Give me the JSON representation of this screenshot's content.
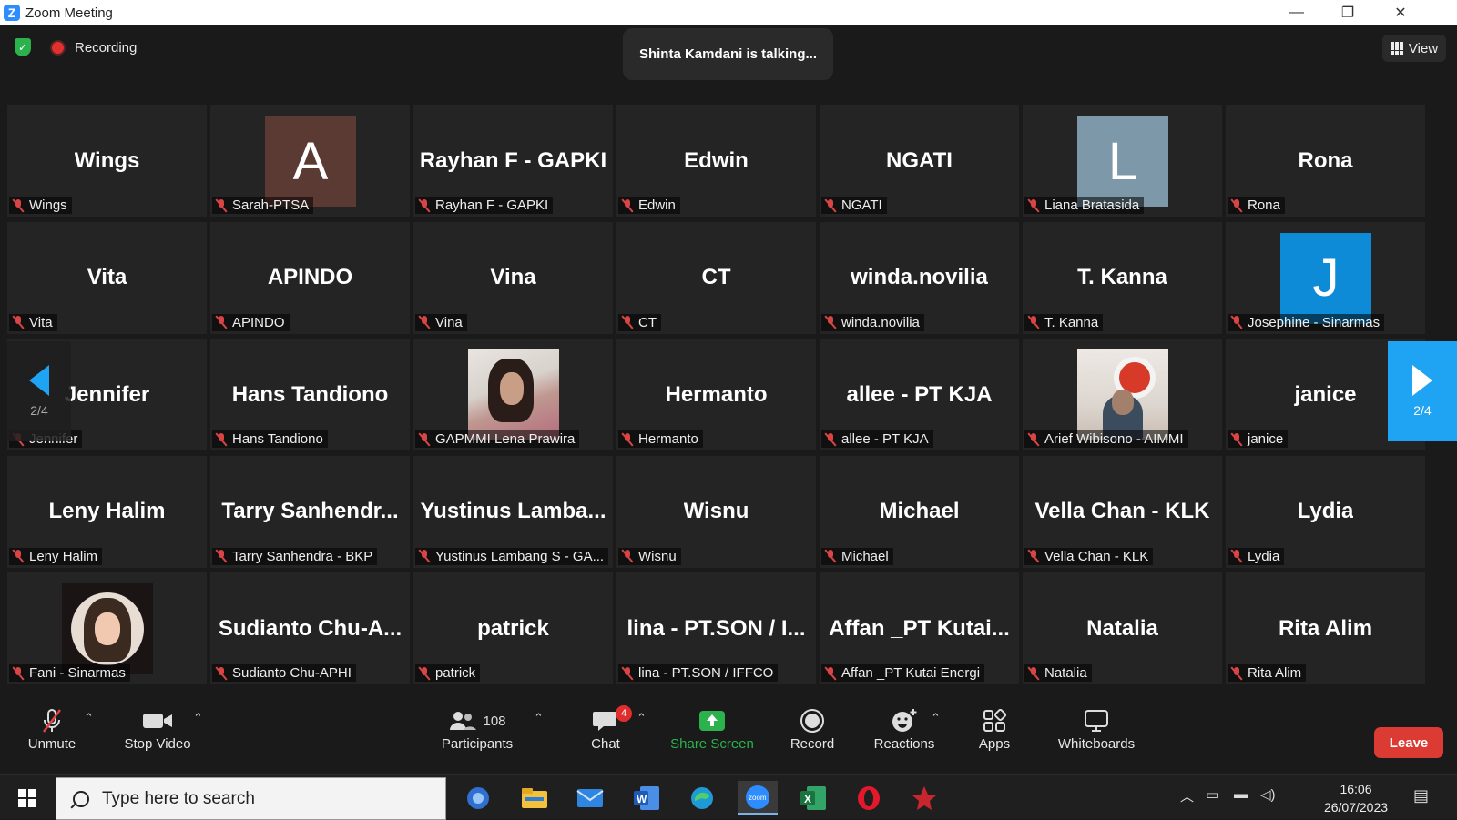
{
  "window": {
    "title": "Zoom Meeting",
    "minimize": "—",
    "restore": "❐",
    "close": "✕"
  },
  "topbar": {
    "recording_label": "Recording",
    "talking_banner": "Shinta Kamdani is talking...",
    "view_label": "View"
  },
  "tiles": [
    {
      "display": "Wings",
      "name": "Wings"
    },
    {
      "display": "A",
      "name": "Sarah-PTSA",
      "avatar_color": "#5b3a33"
    },
    {
      "display": "Rayhan F - GAPKI",
      "name": "Rayhan F - GAPKI"
    },
    {
      "display": "Edwin",
      "name": "Edwin"
    },
    {
      "display": "NGATI",
      "name": "NGATI"
    },
    {
      "display": "L",
      "name": "Liana Bratasida",
      "avatar_color": "#7d98a9"
    },
    {
      "display": "Rona",
      "name": "Rona"
    },
    {
      "display": "Vita",
      "name": "Vita"
    },
    {
      "display": "APINDO",
      "name": "APINDO"
    },
    {
      "display": "Vina",
      "name": "Vina"
    },
    {
      "display": "CT",
      "name": "CT"
    },
    {
      "display": "winda.novilia",
      "name": "winda.novilia"
    },
    {
      "display": "T. Kanna",
      "name": "T. Kanna"
    },
    {
      "display": "J",
      "name": "Josephine - Sinarmas",
      "avatar_color": "#0e8bd6"
    },
    {
      "display": "Jennifer",
      "name": "Jennifer"
    },
    {
      "display": "Hans Tandiono",
      "name": "Hans Tandiono"
    },
    {
      "display": "",
      "name": "GAPMMI Lena Prawira"
    },
    {
      "display": "Hermanto",
      "name": "Hermanto"
    },
    {
      "display": "allee - PT KJA",
      "name": "allee - PT KJA"
    },
    {
      "display": "",
      "name": "Arief Wibisono - AIMMI"
    },
    {
      "display": "janice",
      "name": "janice"
    },
    {
      "display": "Leny Halim",
      "name": "Leny Halim"
    },
    {
      "display": "Tarry  Sanhendr...",
      "name": "Tarry Sanhendra - BKP"
    },
    {
      "display": "Yustinus  Lamba...",
      "name": "Yustinus Lambang S - GA..."
    },
    {
      "display": "Wisnu",
      "name": "Wisnu"
    },
    {
      "display": "Michael",
      "name": "Michael"
    },
    {
      "display": "Vella Chan - KLK",
      "name": "Vella Chan - KLK"
    },
    {
      "display": "Lydia",
      "name": "Lydia"
    },
    {
      "display": "",
      "name": "Fani - Sinarmas"
    },
    {
      "display": "Sudianto  Chu-A...",
      "name": "Sudianto Chu-APHI"
    },
    {
      "display": "patrick",
      "name": "patrick"
    },
    {
      "display": "lina  -  PT.SON  /  I...",
      "name": "lina - PT.SON / IFFCO"
    },
    {
      "display": "Affan  _PT  Kutai...",
      "name": "Affan _PT Kutai Energi"
    },
    {
      "display": "Natalia",
      "name": "Natalia"
    },
    {
      "display": "Rita Alim",
      "name": "Rita Alim"
    }
  ],
  "pager": {
    "left_page": "2/4",
    "right_page": "2/4"
  },
  "toolbar": {
    "unmute": "Unmute",
    "stop_video": "Stop Video",
    "participants": "Participants",
    "participants_count": "108",
    "chat": "Chat",
    "chat_badge": "4",
    "share_screen": "Share Screen",
    "record": "Record",
    "reactions": "Reactions",
    "apps": "Apps",
    "whiteboards": "Whiteboards",
    "leave": "Leave"
  },
  "taskbar": {
    "search_placeholder": "Type here to search",
    "time": "16:06",
    "date": "26/07/2023"
  },
  "colors": {
    "accent": "#1fa4f4",
    "share_green": "#2bb24c",
    "leave_red": "#dc3b33",
    "muted_red": "#d94545"
  }
}
